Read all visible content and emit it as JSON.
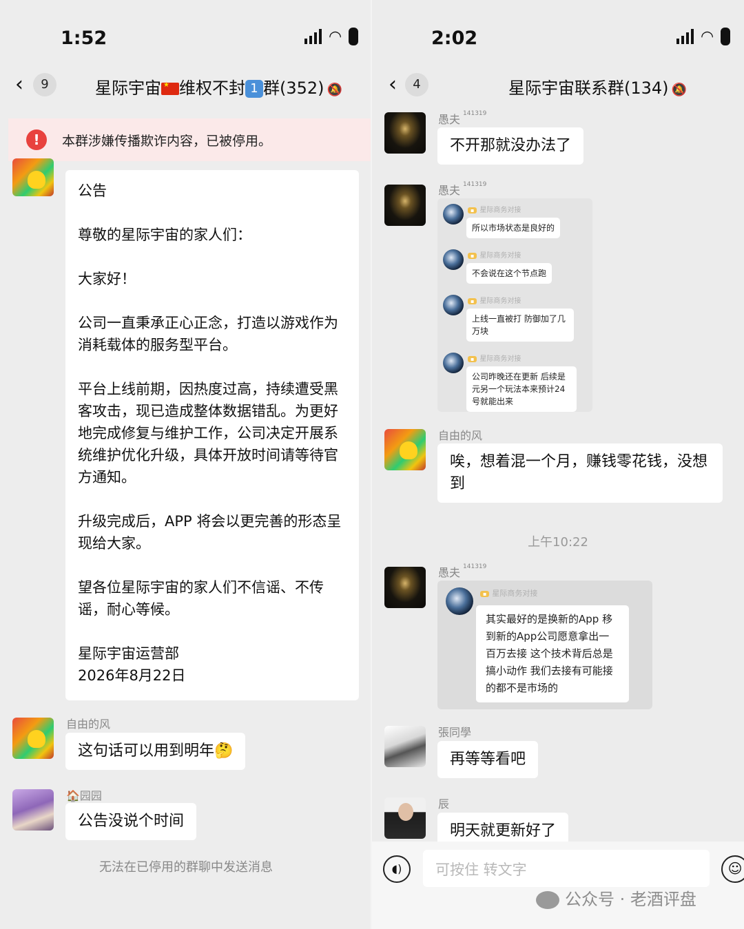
{
  "left": {
    "status_time": "1:52",
    "back_count": "9",
    "title_part1": "星际宇宙",
    "title_part2": "维权不封",
    "title_badge": "1",
    "title_part3": "群(352)",
    "alert_text": "本群涉嫌传播欺诈内容，已被停用。",
    "notice": {
      "paragraphs": [
        "公告",
        "尊敬的星际宇宙的家人们：",
        "大家好！",
        "公司一直秉承正心正念，打造以游戏作为消耗载体的服务型平台。",
        "平台上线前期，因热度过高，持续遭受黑客攻击，现已造成整体数据错乱。为更好地完成修复与维护工作，公司决定开展系统维护优化升级，具体开放时间请等待官方通知。",
        "升级完成后，APP 将会以更完善的形态呈现给大家。",
        "望各位星际宇宙的家人们不信谣、不传谣，耐心等候。",
        "星际宇宙运营部\n2026年8月22日"
      ]
    },
    "messages": [
      {
        "sender": "自由的风",
        "text": "这句话可以用到明年🤔"
      },
      {
        "sender": "园园",
        "text": "公告没说个时间"
      }
    ],
    "disabled_note": "无法在已停用的群聊中发送消息"
  },
  "right": {
    "status_time": "2:02",
    "back_count": "4",
    "title": "星际宇宙联系群(134)",
    "messages": [
      {
        "sender": "愚夫",
        "tag": "141319",
        "text": "不开那就没办法了"
      },
      {
        "sender": "愚夫",
        "tag": "141319",
        "forward": [
          {
            "name": "星际商务对接",
            "text": "所以市场状态是良好的"
          },
          {
            "name": "星际商务对接",
            "text": "不会说在这个节点跑"
          },
          {
            "name": "星际商务对接",
            "text": "上线一直被打 防御加了几万块"
          },
          {
            "name": "星际商务对接",
            "text": "公司昨晚还在更新 后续是元另一个玩法本来预计24号就能出来"
          }
        ]
      },
      {
        "sender": "自由的风",
        "text": "唉，想着混一个月，赚钱零花钱，没想到"
      },
      {
        "sender": "愚夫",
        "tag": "141319",
        "forward": [
          {
            "name": "星际商务对接",
            "text": "其实最好的是换新的App 移到新的App公司愿意拿出一百万去接 这个技术背后总是搞小动作 我们去接有可能接的都不是市场的"
          }
        ]
      },
      {
        "sender": "張同學",
        "text": "再等等看吧"
      },
      {
        "sender": "辰",
        "text": "明天就更新好了"
      }
    ],
    "timestamp": "上午10:22",
    "input_placeholder": "可按住 转文字",
    "watermark": "公众号 · 老酒评盘"
  }
}
